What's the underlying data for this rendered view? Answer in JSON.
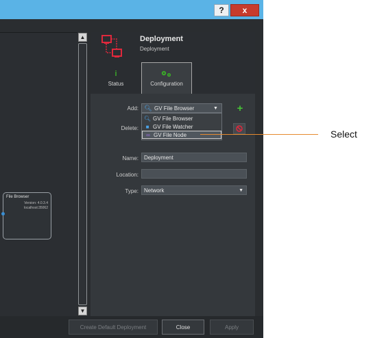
{
  "titlebar": {
    "help_label": "?",
    "close_label": "x"
  },
  "canvas": {
    "node": {
      "title": "File Browser",
      "version": "Version: 4.0.3.4",
      "host": "localhost:35062"
    }
  },
  "header": {
    "title": "Deployment",
    "subtitle": "Deployment"
  },
  "tabs": [
    {
      "label": "Status",
      "icon": "info-icon"
    },
    {
      "label": "Configuration",
      "icon": "gears-icon"
    }
  ],
  "form": {
    "add_label": "Add:",
    "add_value": "GV File Browser",
    "delete_label": "Delete:",
    "name_label": "Name:",
    "name_value": "Deployment",
    "location_label": "Location:",
    "location_value": "",
    "type_label": "Type:",
    "type_value": "Network"
  },
  "dropdown": {
    "options": [
      "GV File Browser",
      "GV File Watcher",
      "GV File Node"
    ],
    "highlighted": "GV File Node"
  },
  "footer": {
    "create_default_label": "Create Default Deployment",
    "close_label": "Close",
    "apply_label": "Apply"
  },
  "callout": {
    "text": "Select"
  },
  "colors": {
    "titlebar": "#5ab3e6",
    "accent_green": "#3aa829",
    "deployment_red": "#e0283c",
    "callout_orange": "#e68a2e"
  }
}
